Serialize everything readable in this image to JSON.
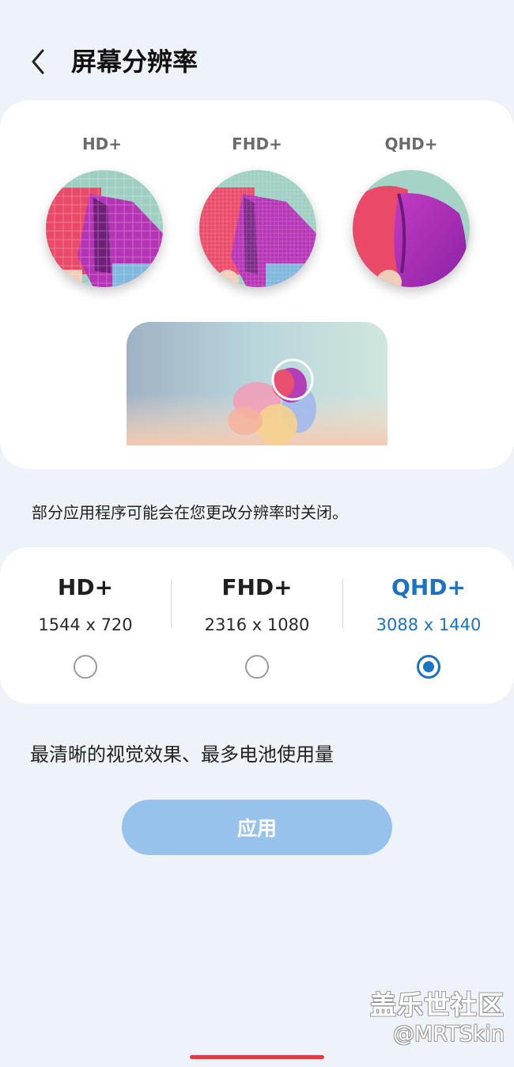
{
  "header": {
    "title": "屏幕分辨率"
  },
  "preview": {
    "labels": [
      "HD+",
      "FHD+",
      "QHD+"
    ]
  },
  "note": "部分应用程序可能会在您更改分辨率时关闭。",
  "options": [
    {
      "name": "HD+",
      "dims": "1544 x 720",
      "selected": false
    },
    {
      "name": "FHD+",
      "dims": "2316 x 1080",
      "selected": false
    },
    {
      "name": "QHD+",
      "dims": "3088 x 1440",
      "selected": true
    }
  ],
  "description": "最清晰的视觉效果、最多电池使用量",
  "apply_label": "应用",
  "watermark": {
    "line1": "盖乐世社区",
    "line2": "@MRTSkin"
  },
  "colors": {
    "accent": "#1a73c4",
    "apply_button": "#97c2ec",
    "background": "#eef2f9"
  },
  "icons": {
    "back": "chevron-left-icon"
  }
}
